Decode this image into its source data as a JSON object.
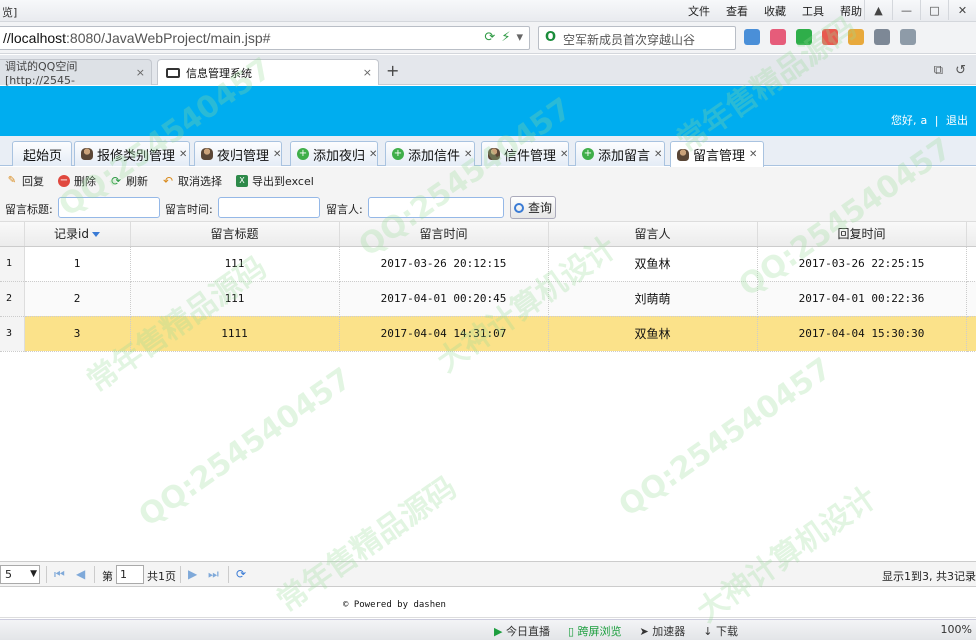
{
  "browser": {
    "window_title": "览]",
    "menus": [
      "文件",
      "查看",
      "收藏",
      "工具",
      "帮助"
    ],
    "url_host": "//localhost",
    "url_rest": ":8080/JavaWebProject/main.jsp#",
    "search_text": "空军新成员首次穿越山谷",
    "tabs": [
      {
        "label": "调试的QQ空间 [http://2545-"
      },
      {
        "label": "信息管理系统"
      }
    ],
    "new_tab": "+"
  },
  "header": {
    "greeting": "您好,",
    "user": "a",
    "divider": "|",
    "logout": "退出"
  },
  "app_tabs": [
    {
      "label": "起始页",
      "icon": "none",
      "closable": false
    },
    {
      "label": "报修类别管理",
      "icon": "person",
      "closable": true
    },
    {
      "label": "夜归管理",
      "icon": "person",
      "closable": true
    },
    {
      "label": "添加夜归",
      "icon": "plus",
      "closable": true
    },
    {
      "label": "添加信件",
      "icon": "plus",
      "closable": true
    },
    {
      "label": "信件管理",
      "icon": "person",
      "closable": true
    },
    {
      "label": "添加留言",
      "icon": "plus",
      "closable": true
    },
    {
      "label": "留言管理",
      "icon": "person",
      "closable": true
    }
  ],
  "toolbar": {
    "reply": "回复",
    "delete": "删除",
    "refresh": "刷新",
    "cancel_select": "取消选择",
    "export": "导出到excel"
  },
  "search": {
    "title_label": "留言标题:",
    "time_label": "留言时间:",
    "person_label": "留言人:",
    "button": "查询"
  },
  "grid": {
    "columns": [
      "记录id",
      "留言标题",
      "留言时间",
      "留言人",
      "回复时间"
    ],
    "rows": [
      {
        "rn": "1",
        "id": "1",
        "title": "111",
        "time": "2017-03-26 20:12:15",
        "person": "双鱼林",
        "reply_time": "2017-03-26 22:25:15"
      },
      {
        "rn": "2",
        "id": "2",
        "title": "111",
        "time": "2017-04-01 00:20:45",
        "person": "刘萌萌",
        "reply_time": "2017-04-01 00:22:36"
      },
      {
        "rn": "3",
        "id": "3",
        "title": "1111",
        "time": "2017-04-04 14:31:07",
        "person": "双鱼林",
        "reply_time": "2017-04-04 15:30:30"
      }
    ]
  },
  "pager": {
    "page_size": "5",
    "page_prefix": "第",
    "page_value": "1",
    "page_suffix": "共1页",
    "info": "显示1到3, 共3记录"
  },
  "footer": {
    "powered": "© Powered by dashen"
  },
  "statusbar": {
    "items": [
      "今日直播",
      "跨屏浏览",
      "加速器",
      "下载"
    ],
    "zoom": "100%"
  },
  "watermark": {
    "texts": [
      "QQ:254540457",
      "常年售精品源码",
      "大神计算机设计"
    ]
  }
}
